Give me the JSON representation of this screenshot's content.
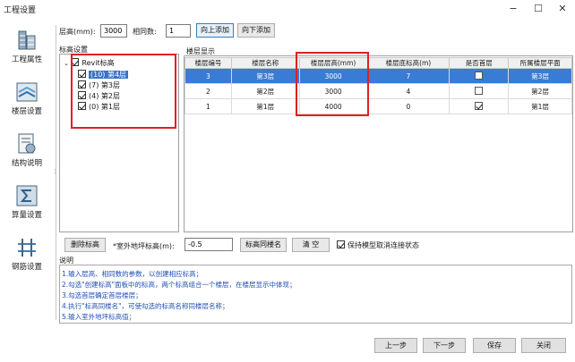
{
  "window": {
    "title": "工程设置",
    "minimize": "−",
    "maximize": "☐",
    "close": "✕"
  },
  "sidebar": {
    "items": [
      {
        "label": "工程属性",
        "icon": "building-icon"
      },
      {
        "label": "楼层设置",
        "icon": "floors-icon"
      },
      {
        "label": "结构说明",
        "icon": "structure-doc-icon"
      },
      {
        "label": "算量设置",
        "icon": "sigma-icon"
      },
      {
        "label": "钢筋设置",
        "icon": "rebar-icon"
      }
    ]
  },
  "toprow": {
    "height_label": "层高(mm):",
    "height_value": "3000",
    "count_label": "相同数:",
    "count_value": "1",
    "add_up_label": "向上添加",
    "add_down_label": "向下添加"
  },
  "tree": {
    "group_label": "标高设置",
    "root": "Revit标高",
    "items": [
      {
        "label": "(10) 第4层",
        "checked": true,
        "selected": true
      },
      {
        "label": "(7) 第3层",
        "checked": true,
        "selected": false
      },
      {
        "label": "(4) 第2层",
        "checked": true,
        "selected": false
      },
      {
        "label": "(0) 第1层",
        "checked": true,
        "selected": false
      }
    ]
  },
  "floors": {
    "group_label": "楼层显示",
    "columns": [
      "楼层编号",
      "楼层名称",
      "楼层层高(mm)",
      "楼层底标高(m)",
      "是否首层",
      "所属楼层平面"
    ],
    "rows": [
      {
        "no": "3",
        "name": "第3层",
        "height": "3000",
        "base": "7",
        "first": false,
        "plan": "第3层",
        "selected": true
      },
      {
        "no": "2",
        "name": "第2层",
        "height": "3000",
        "base": "4",
        "first": false,
        "plan": "第2层",
        "selected": false
      },
      {
        "no": "1",
        "name": "第1层",
        "height": "4000",
        "base": "0",
        "first": true,
        "plan": "第1层",
        "selected": false
      }
    ]
  },
  "bottom": {
    "delete_label": "删除标高",
    "outdoor_label": "*室外地坪标高(m):",
    "outdoor_value": "-0.5",
    "rename_label": "标高同楼名",
    "clear_label": "清 空",
    "keep_label": "保持模型取消连接状态",
    "keep_checked": true
  },
  "description": {
    "title": "说明",
    "lines": [
      "1.输入层高、相同数的参数，以创建相应标高；",
      "2.勾选\"创建标高\"面板中的标高，两个标高组合一个楼层，在楼层显示中体现；",
      "3.勾选首层确定首层楼层；",
      "4.执行\"标高同楼名\"，可使勾选的标高名称同楼层名称；",
      "5.输入室外地坪标高值；"
    ]
  },
  "footer": {
    "prev": "上一步",
    "next": "下一步",
    "save": "保存",
    "close": "关闭"
  }
}
